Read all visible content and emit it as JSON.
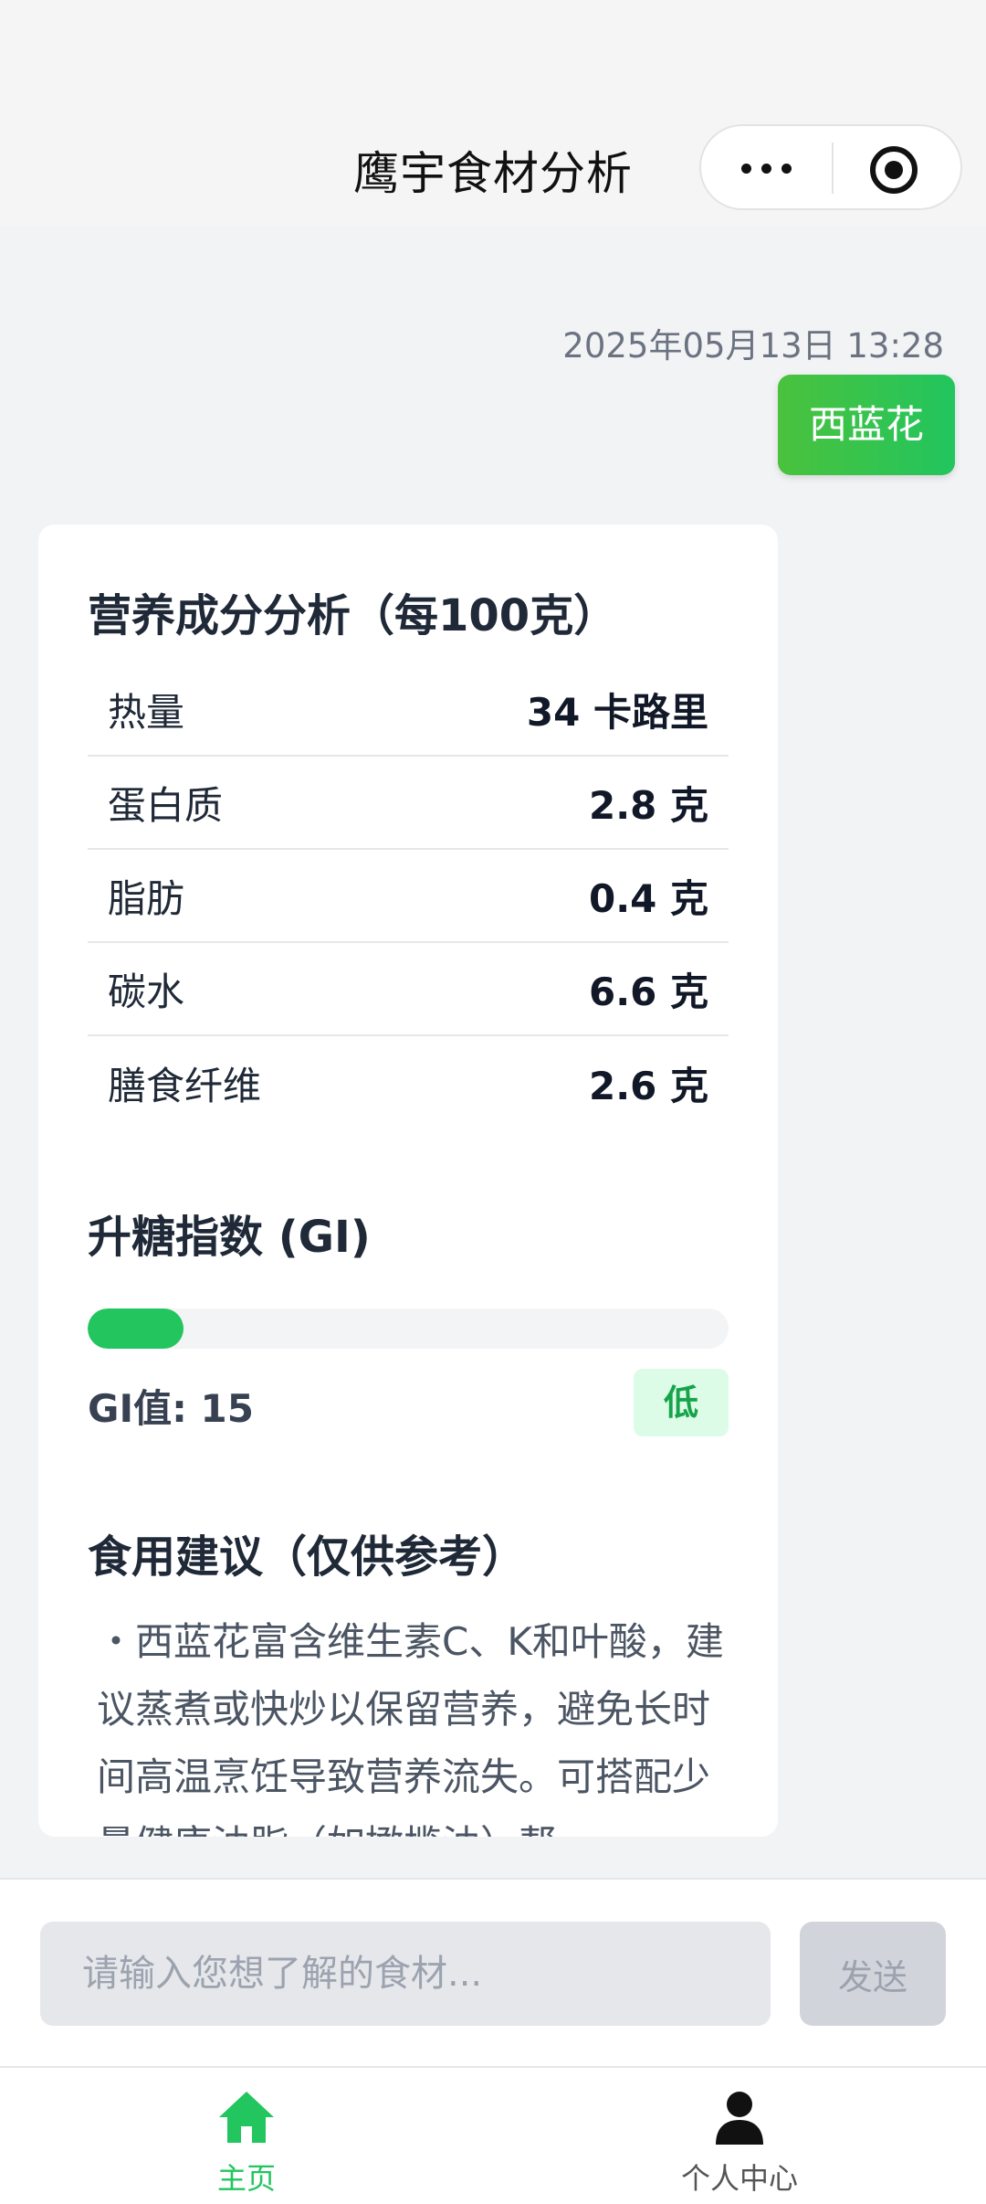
{
  "header": {
    "title": "鹰宇食材分析"
  },
  "chat": {
    "timestamp": "2025年05月13日 13:28",
    "user_message": "西蓝花"
  },
  "analysis": {
    "nutrition_title": "营养成分分析（每100克）",
    "nutrients": [
      {
        "name": "热量",
        "value": "34 卡路里"
      },
      {
        "name": "蛋白质",
        "value": "2.8 克"
      },
      {
        "name": "脂肪",
        "value": "0.4 克"
      },
      {
        "name": "碳水",
        "value": "6.6 克"
      },
      {
        "name": "膳食纤维",
        "value": "2.6 克"
      }
    ],
    "gi_title": "升糖指数 (GI)",
    "gi_value_text": "GI值: 15",
    "gi_level": "低",
    "gi_fill_fraction": 0.15,
    "gi_color": "#22c55e",
    "advice_title": "食用建议（仅供参考）",
    "advice_text": "・西蓝花富含维生素C、K和叶酸，建议蒸煮或快炒以保留营养，避免长时间高温烹饪导致营养流失。可搭配少量健康油脂（如橄榄油）帮"
  },
  "input": {
    "placeholder": "请输入您想了解的食材...",
    "send_label": "发送"
  },
  "tabs": [
    {
      "label": "主页",
      "icon": "home-icon",
      "active": true
    },
    {
      "label": "个人中心",
      "icon": "person-icon",
      "active": false
    }
  ],
  "colors": {
    "accent": "#22c55e",
    "active_tab": "#22c55e"
  }
}
